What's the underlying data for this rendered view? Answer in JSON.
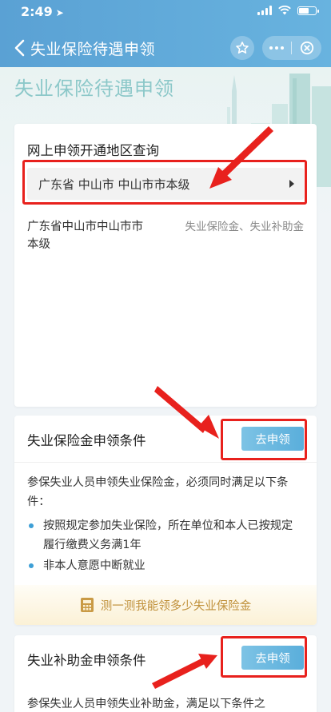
{
  "status_bar": {
    "time": "2:49",
    "location_glyph": "➤"
  },
  "nav": {
    "title": "失业保险待遇申领"
  },
  "banner": {
    "title": "失业保险待遇申领"
  },
  "region_card": {
    "title": "网上申领开通地区查询",
    "selected_region": "广东省  中山市  中山市市本级",
    "result": {
      "name": "广东省中山市中山市市本级",
      "benefits": "失业保险金、失业补助金"
    }
  },
  "insurance_card": {
    "title": "失业保险金申领条件",
    "apply_label": "去申领",
    "intro": "参保失业人员申领失业保险金，必须同时满足以下条件：",
    "conditions": [
      "按照规定参加失业保险，所在单位和本人已按规定履行缴费义务满1年",
      "非本人意愿中断就业"
    ],
    "calculator_label": "测一测我能领多少失业保险金"
  },
  "subsidy_card": {
    "title": "失业补助金申领条件",
    "apply_label": "去申领",
    "intro": "参保失业人员申领失业补助金，满足以下条件之"
  },
  "colors": {
    "header_blue": "#5aa1d4",
    "button_blue": "#5aaedb",
    "annotation_red": "#e8211d",
    "bullet_blue": "#3d9fd6",
    "calculator_gold": "#c0913b"
  }
}
